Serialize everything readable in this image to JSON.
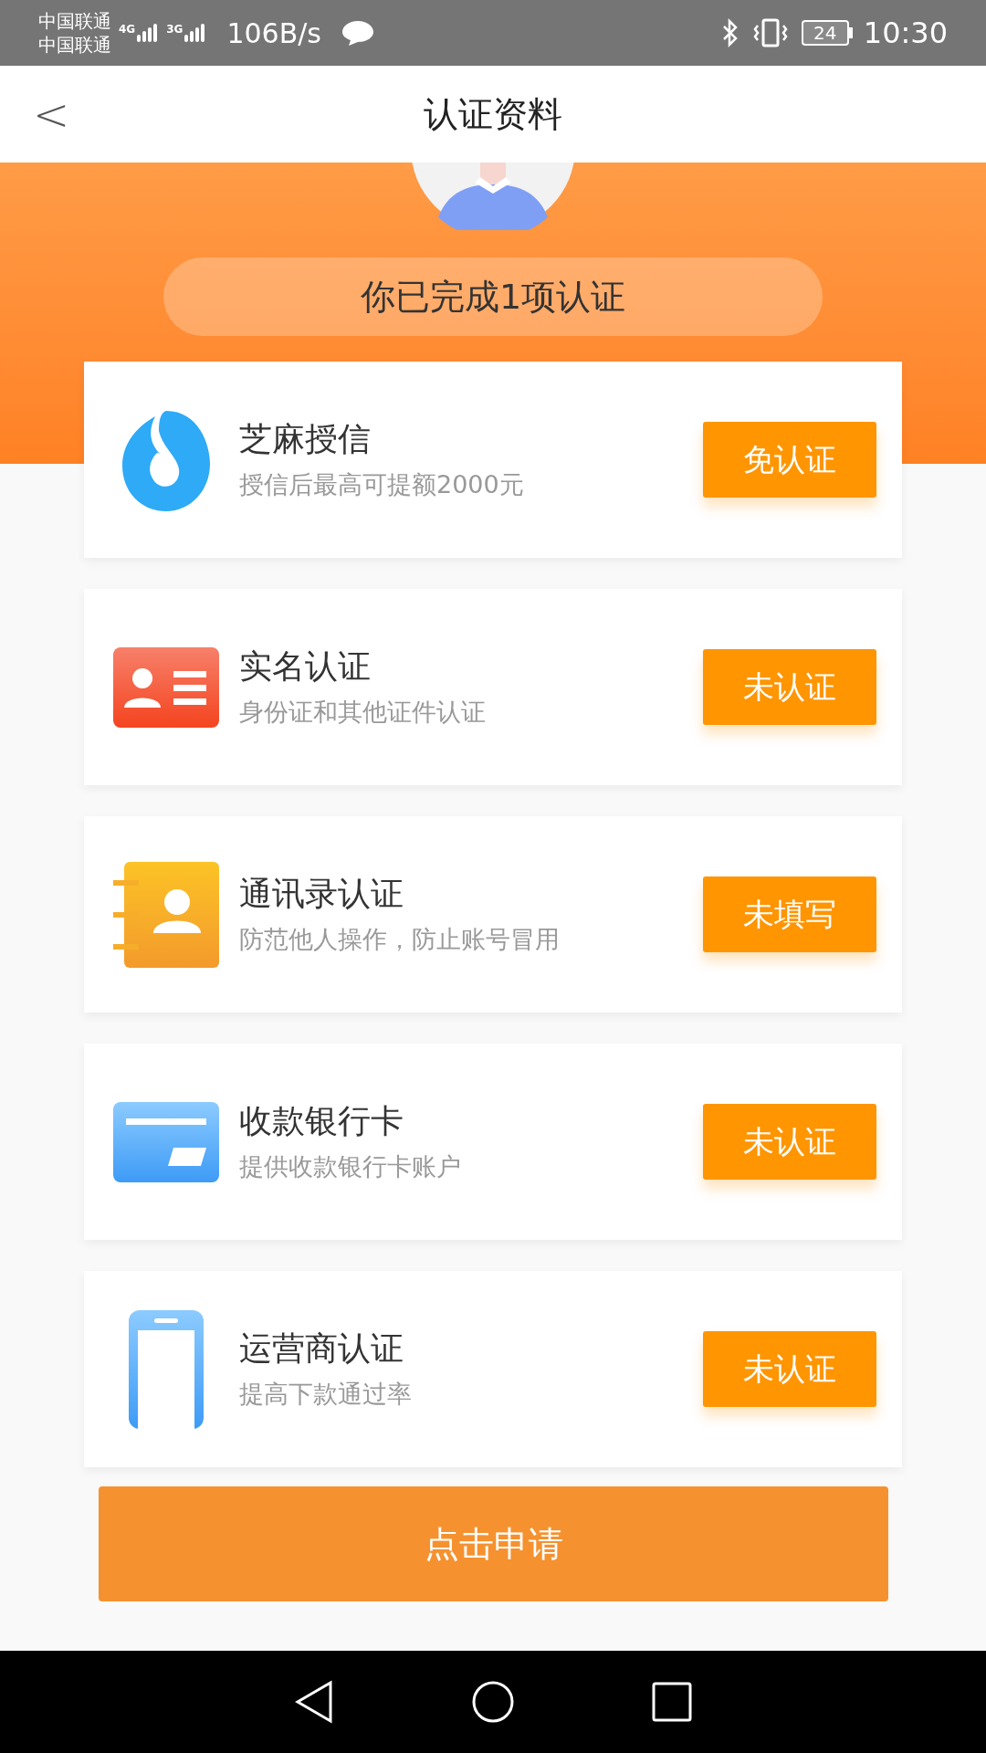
{
  "status_bar": {
    "carriers": [
      "中国联通",
      "中国联通"
    ],
    "network_labels": [
      "4G",
      "3G"
    ],
    "speed": "106B/s",
    "battery": "24",
    "time": "10:30"
  },
  "header": {
    "back": "<",
    "title": "认证资料"
  },
  "summary": "你已完成1项认证",
  "items": [
    {
      "title": "芝麻授信",
      "subtitle": "授信后最高可提额2000元",
      "status": "免认证"
    },
    {
      "title": "实名认证",
      "subtitle": "身份证和其他证件认证",
      "status": "未认证"
    },
    {
      "title": "通讯录认证",
      "subtitle": "防范他人操作，防止账号冒用",
      "status": "未填写"
    },
    {
      "title": "收款银行卡",
      "subtitle": "提供收款银行卡账户",
      "status": "未认证"
    },
    {
      "title": "运营商认证",
      "subtitle": "提高下款通过率",
      "status": "未认证"
    }
  ],
  "apply_button": "点击申请"
}
